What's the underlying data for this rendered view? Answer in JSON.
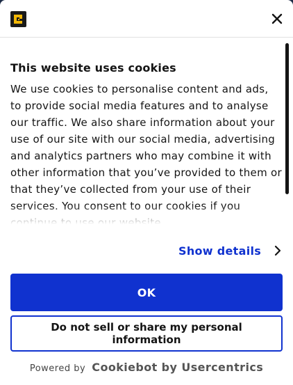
{
  "header": {
    "logo_icon": "brand-logo-icon",
    "close_icon": "close-icon"
  },
  "content": {
    "title": "This website uses cookies",
    "body": "We use cookies to personalise content and ads, to provide social media features and to analyse our traffic. We also share information about your use of our site with our social media, advertising and analytics partners who may combine it with other information that you’ve provided to them or that they’ve collected from your use of their services. You consent to our cookies if you continue to use our website."
  },
  "details": {
    "label": "Show details",
    "icon": "chevron-right-icon"
  },
  "buttons": {
    "ok_label": "OK",
    "do_not_sell_label": "Do not sell or share my personal information"
  },
  "footer": {
    "powered_by": "Powered by",
    "brand": "Cookiebot by Usercentrics"
  },
  "colors": {
    "accent": "#1032cf",
    "text": "#141414",
    "backdrop": "#1b2a45"
  }
}
